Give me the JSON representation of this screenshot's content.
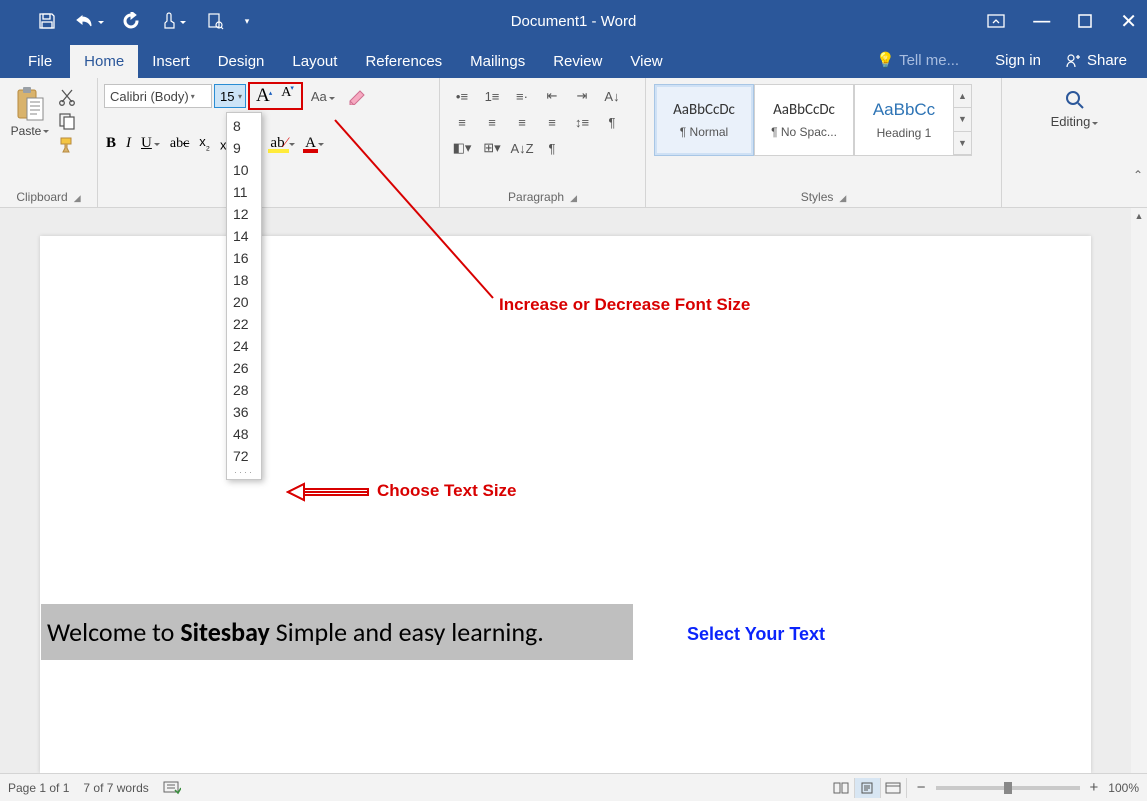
{
  "titlebar": {
    "title": "Document1 - Word"
  },
  "tabs": {
    "file": "File",
    "items": [
      "Home",
      "Insert",
      "Design",
      "Layout",
      "References",
      "Mailings",
      "Review",
      "View"
    ],
    "tell": "Tell me...",
    "signin": "Sign in",
    "share": "Share"
  },
  "ribbon": {
    "clipboard": {
      "paste": "Paste",
      "label": "Clipboard"
    },
    "font": {
      "name": "Calibri (Body)",
      "size": "15",
      "case": "Aa",
      "sizes": [
        "8",
        "9",
        "10",
        "11",
        "12",
        "14",
        "16",
        "18",
        "20",
        "22",
        "24",
        "26",
        "28",
        "36",
        "48",
        "72"
      ]
    },
    "paragraph": {
      "label": "Paragraph"
    },
    "styles": {
      "label": "Styles",
      "items": [
        {
          "preview": "AaBbCcDc",
          "name": "¶ Normal",
          "heading": false
        },
        {
          "preview": "AaBbCcDc",
          "name": "¶ No Spac...",
          "heading": false
        },
        {
          "preview": "AaBbCc",
          "name": "Heading 1",
          "heading": true
        }
      ]
    },
    "editing": {
      "label": "Editing"
    }
  },
  "annotations": {
    "inc_dec": "Increase or Decrease Font Size",
    "choose": "Choose Text Size",
    "select": "Select Your Text"
  },
  "document": {
    "text_pre": "Welcome to ",
    "text_bold": "Sitesbay",
    "text_post": " Simple and easy learning."
  },
  "status": {
    "page": "Page 1 of 1",
    "words": "7 of 7 words",
    "zoom": "100%"
  }
}
